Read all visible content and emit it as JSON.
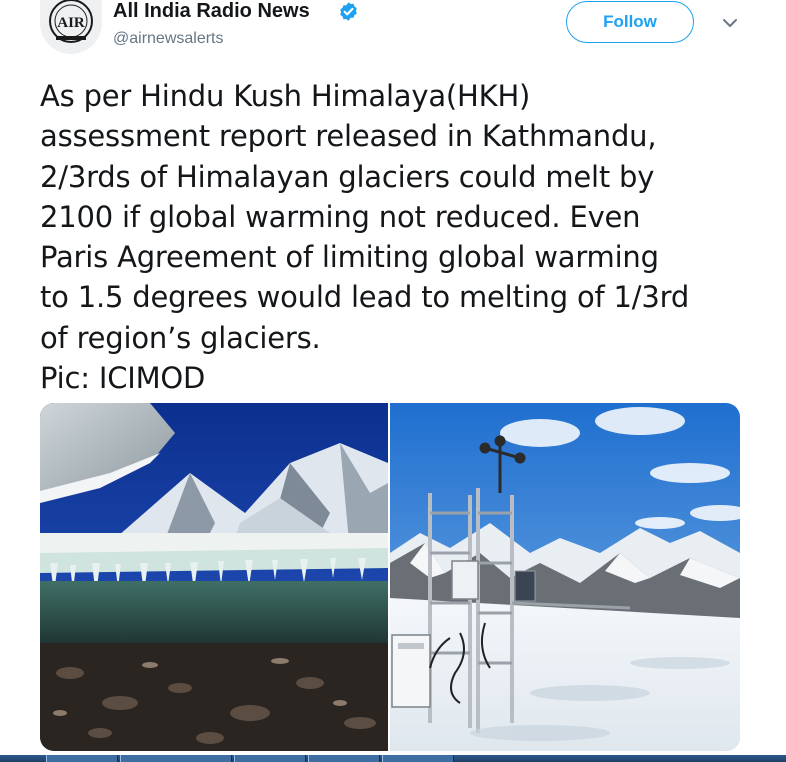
{
  "tweet": {
    "display_name": "All India Radio News",
    "handle": "@airnewsalerts",
    "verified": true,
    "follow_label": "Follow",
    "more_icon": "chevron-down-icon",
    "avatar_icon": "air-logo-icon",
    "text_lines": [
      "As per Hindu Kush Himalaya(HKH)",
      "assessment report released in Kathmandu,",
      "2/3rds of Himalayan glaciers could melt by",
      "2100 if global warming not reduced. Even",
      "Paris Agreement of limiting global warming",
      "to 1.5 degrees would lead to melting of 1/3rd",
      "of region’s glaciers.",
      "Pic: ICIMOD"
    ],
    "media": [
      {
        "kind": "photo",
        "subject": "glacier-ice-cave-stream"
      },
      {
        "kind": "photo",
        "subject": "weather-station-snow-mountains"
      }
    ]
  },
  "colors": {
    "accent": "#1da1f2",
    "text": "#14171a",
    "secondary_text": "#657786",
    "taskbar": "#24497a"
  }
}
